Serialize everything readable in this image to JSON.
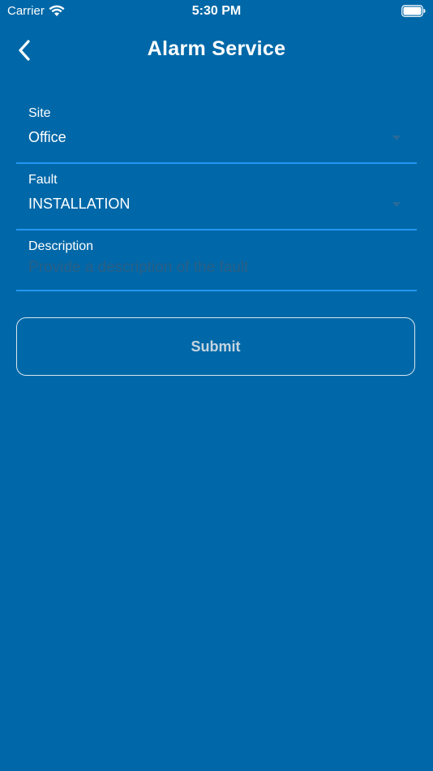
{
  "status_bar": {
    "carrier": "Carrier",
    "time": "5:30 PM",
    "icons": [
      "wifi-icon",
      "battery-icon"
    ]
  },
  "header": {
    "title": "Alarm Service",
    "back_icon": "chevron-left-icon"
  },
  "form": {
    "site": {
      "label": "Site",
      "value": "Office"
    },
    "fault": {
      "label": "Fault",
      "value": "INSTALLATION"
    },
    "description": {
      "label": "Description",
      "placeholder": "Provide a description of the fault",
      "value": ""
    },
    "submit_label": "Submit"
  },
  "colors": {
    "background": "#0068a8",
    "field_underline": "#2196f3",
    "placeholder": "#2a5f86",
    "button_text": "#c6d4df"
  }
}
